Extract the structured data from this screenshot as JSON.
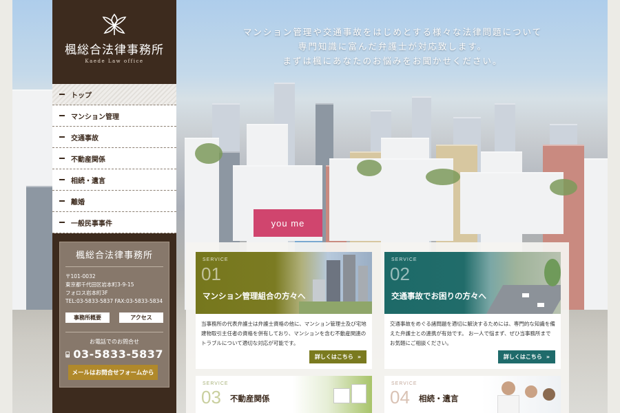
{
  "header": {
    "tagline": [
      "マンション管理や交通事故をはじめとする様々な法律問題について",
      "専門知識に富んだ弁護士が対応致します。",
      "まずは楓にあなたのお悩みをお聞かせください。"
    ],
    "sign_text": "you me"
  },
  "logo": {
    "icon": "maple-leaf-icon",
    "title": "楓総合法律事務所",
    "subtitle": "Kaede Law office"
  },
  "nav": {
    "items": [
      {
        "label": "トップ"
      },
      {
        "label": "マンション管理"
      },
      {
        "label": "交通事故"
      },
      {
        "label": "不動産関係"
      },
      {
        "label": "相続・遺言"
      },
      {
        "label": "離婚"
      },
      {
        "label": "一般民事事件"
      }
    ]
  },
  "office": {
    "title": "楓総合法律事務所",
    "address": [
      "〒101-0032",
      "東京都千代田区岩本町3-9-15",
      "フォロス岩本町3F",
      "TEL:03-5833-5837 FAX:03-5833-5834"
    ],
    "overview_button": "事務所概要",
    "access_button": "アクセス",
    "phone_label": "お電話でのお問合せ",
    "phone": "03-5833-5837",
    "phone_icon": "phone-icon",
    "mail_button": "メールはお問合せフォームから"
  },
  "services": [
    {
      "label": "SERVICE",
      "number": "01",
      "title": "マンション管理組合の方々へ",
      "text": "当事務所の代表弁護士は弁護士資格の他に、マンション管理士及び宅地建物取引主任者の資格を併有しており、マンションを含む不動産関連のトラブルについて適切な対応が可能です。",
      "more": "詳しくはこちら",
      "more_arrow": "»"
    },
    {
      "label": "SERVICE",
      "number": "02",
      "title": "交通事故でお困りの方々へ",
      "text": "交通事故をめぐる諸問題を適切に解決するためには、専門的な知識を備えた弁護士との連携が有効です。 お一人で悩まず、ぜひ当事務所までお気軽にご相談ください。",
      "more": "詳しくはこちら",
      "more_arrow": "»"
    },
    {
      "label": "SERVICE",
      "number": "03",
      "title": "不動産関係"
    },
    {
      "label": "SERVICE",
      "number": "04",
      "title": "相続・遺言"
    }
  ],
  "colors": {
    "brown": "#3d2b1e",
    "olive": "#7a7a1f",
    "teal": "#1f6b6b",
    "gold": "#b0892b"
  }
}
